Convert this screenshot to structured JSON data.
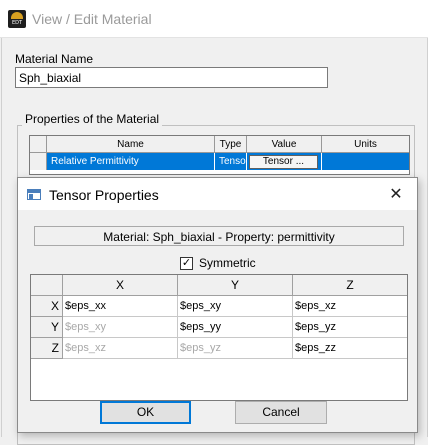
{
  "window": {
    "title": "View / Edit Material",
    "icon": "app-logo-icon",
    "icon_text": "EDT"
  },
  "material_name": {
    "label": "Material Name",
    "value": "Sph_biaxial"
  },
  "properties": {
    "group_label": "Properties of the Material",
    "columns": [
      "Name",
      "Type",
      "Value",
      "Units"
    ],
    "rows": [
      {
        "name": "Relative Permittivity",
        "type": "Tensor",
        "value": "Tensor ...",
        "units": ""
      }
    ],
    "selection_color": "#0078d7"
  },
  "dialog": {
    "title": "Tensor Properties",
    "icon": "window-icon",
    "close_icon": "close-icon",
    "info": "Material:  Sph_biaxial - Property:  permittivity",
    "symmetric": {
      "label": "Symmetric",
      "checked": true,
      "check_glyph": "✓"
    },
    "tensor": {
      "columns": [
        "X",
        "Y",
        "Z"
      ],
      "rows": [
        {
          "label": "X",
          "cells": [
            "$eps_xx",
            "$eps_xy",
            "$eps_xz"
          ]
        },
        {
          "label": "Y",
          "cells": [
            "$eps_xy",
            "$eps_yy",
            "$eps_yz"
          ]
        },
        {
          "label": "Z",
          "cells": [
            "$eps_xz",
            "$eps_yz",
            "$eps_zz"
          ]
        }
      ]
    },
    "ok_label": "OK",
    "cancel_label": "Cancel"
  }
}
